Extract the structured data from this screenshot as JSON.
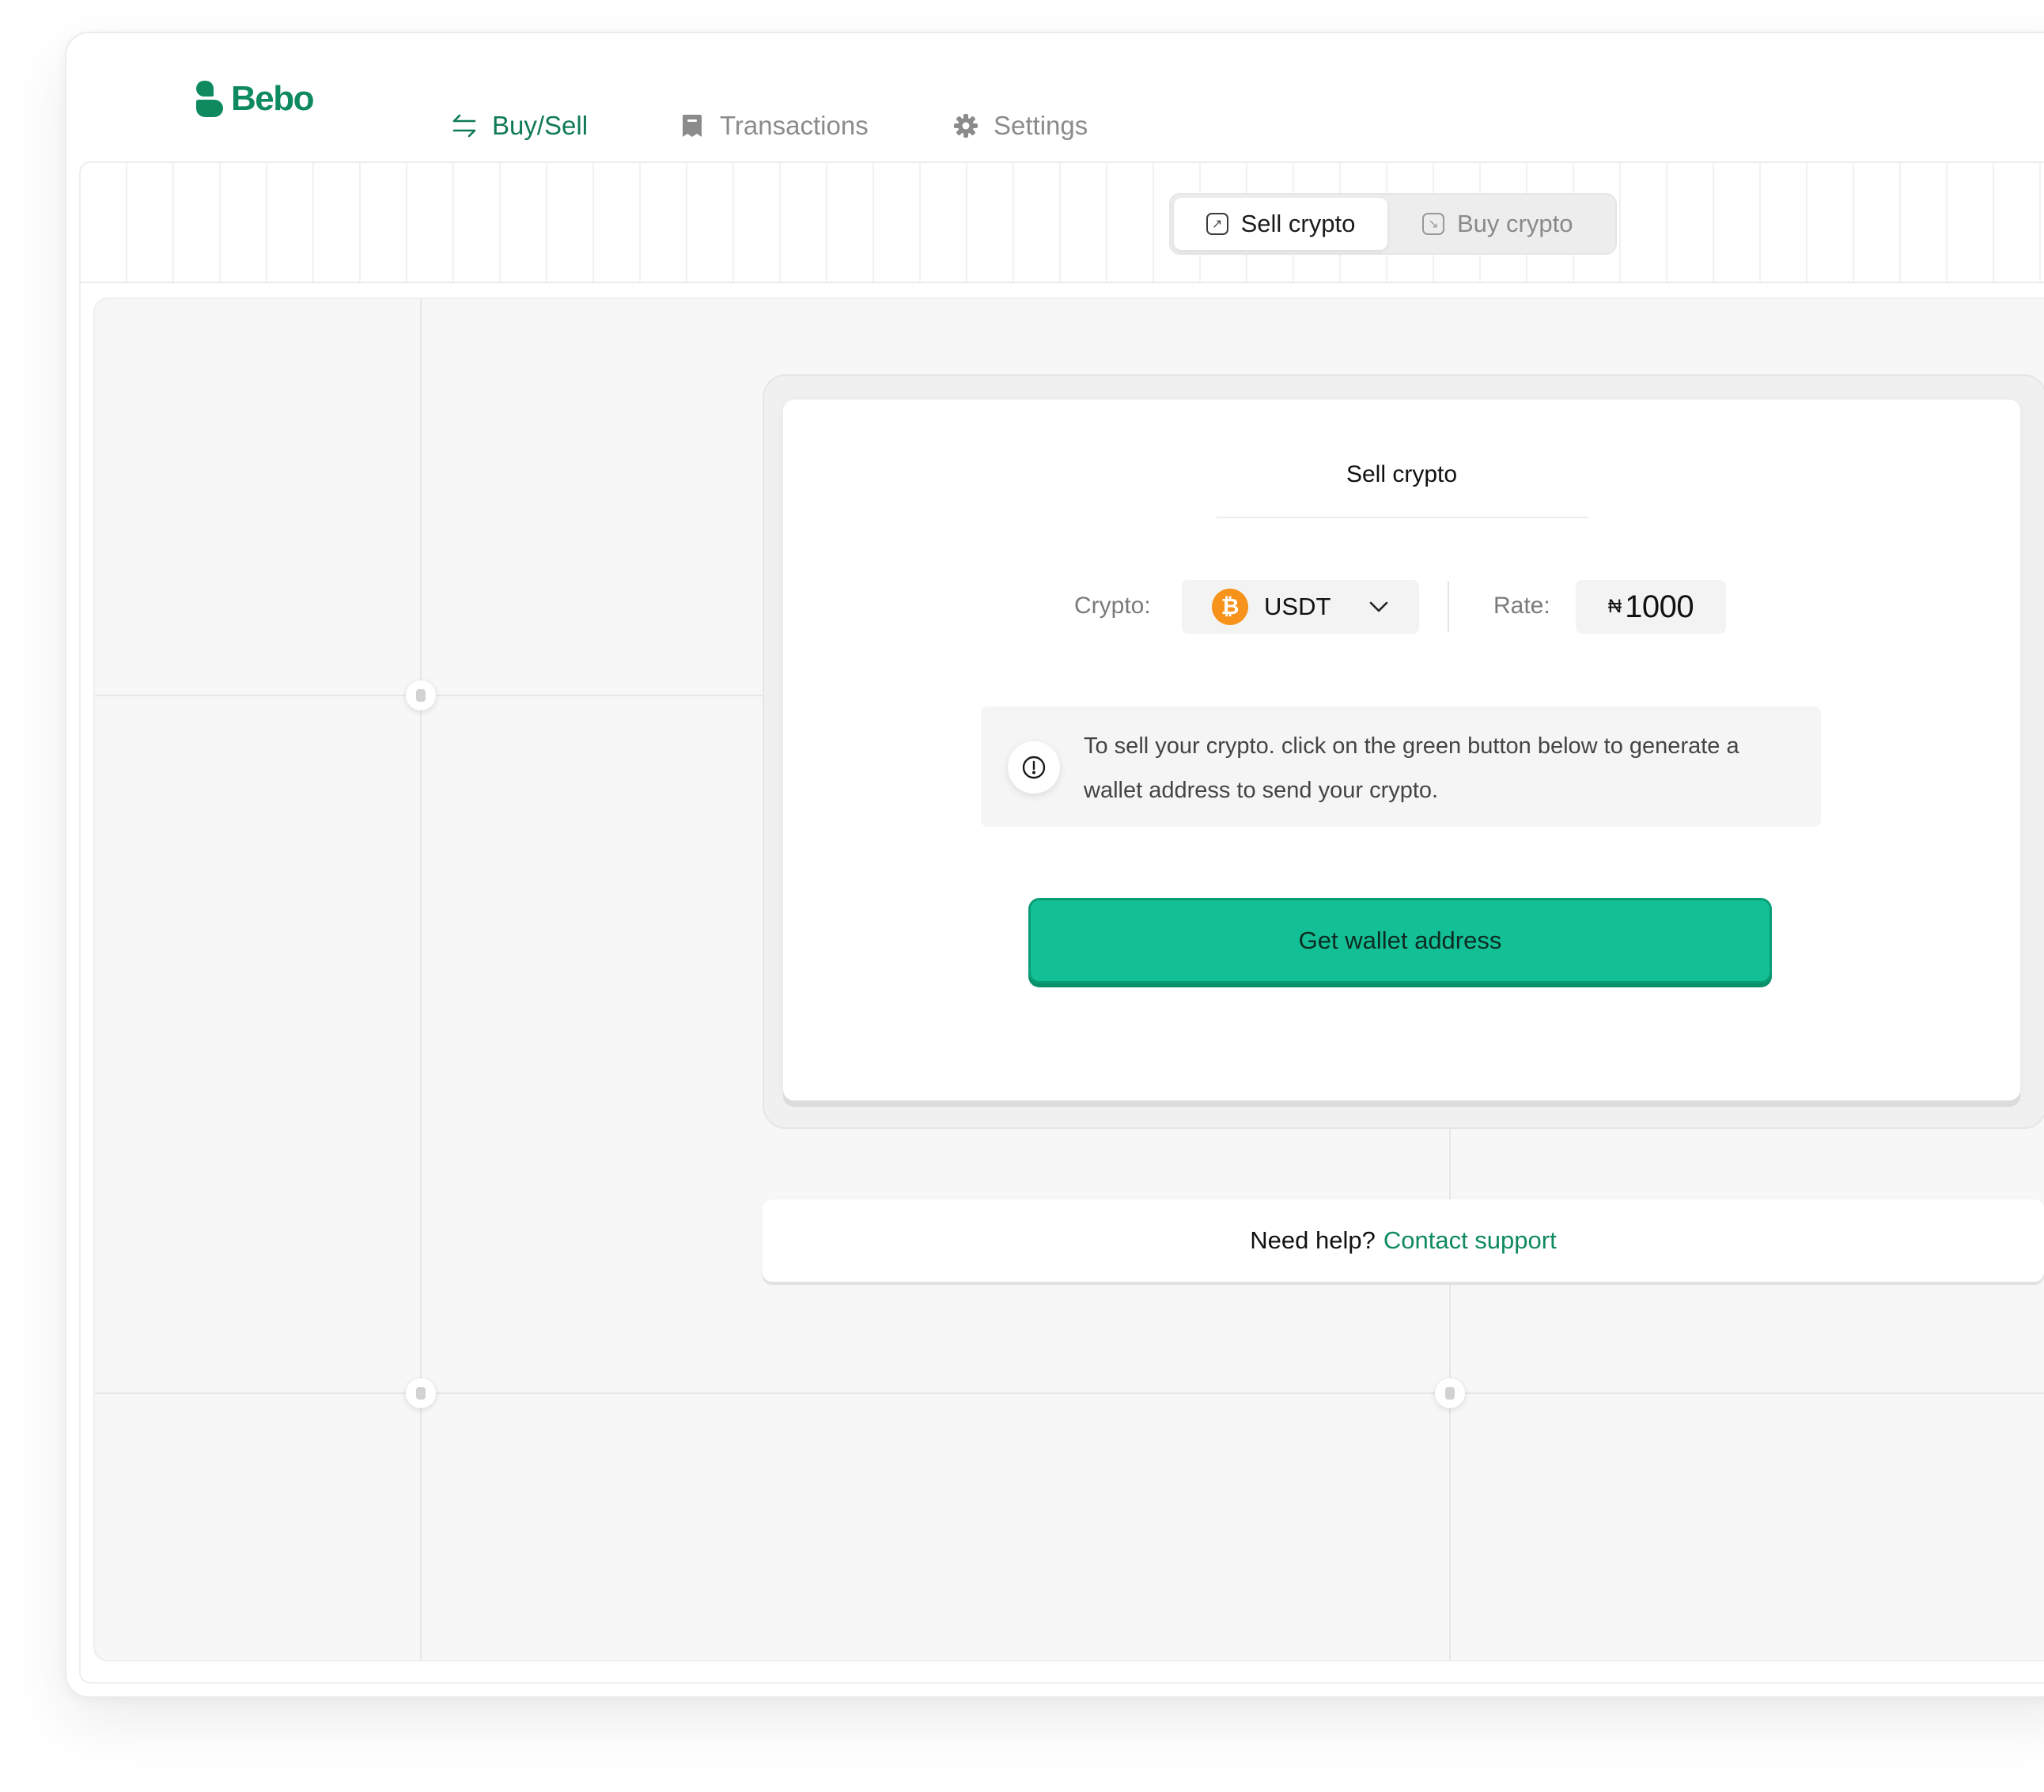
{
  "brand": {
    "name": "Bebo",
    "color": "#0f8a5f"
  },
  "nav": {
    "items": [
      {
        "label": "Buy/Sell",
        "icon": "swap-arrows-icon",
        "active": true
      },
      {
        "label": "Transactions",
        "icon": "receipt-icon",
        "active": false
      },
      {
        "label": "Settings",
        "icon": "gear-icon",
        "active": false
      }
    ]
  },
  "mode_toggle": {
    "options": [
      {
        "label": "Sell crypto",
        "icon": "arrow-up-right-icon",
        "selected": true
      },
      {
        "label": "Buy crypto",
        "icon": "arrow-down-right-icon",
        "selected": false
      }
    ]
  },
  "sell_card": {
    "title": "Sell crypto",
    "crypto_label": "Crypto:",
    "crypto_value": "USDT",
    "coin_icon": "bitcoin-icon",
    "rate_label": "Rate:",
    "rate_currency": "₦",
    "rate_value": "1000",
    "notice": "To sell your crypto. click on the green button below to generate a wallet address to send your crypto.",
    "primary_button": "Get wallet address",
    "accent_color": "#13c096"
  },
  "help": {
    "text": "Need help?",
    "link": "Contact support"
  }
}
